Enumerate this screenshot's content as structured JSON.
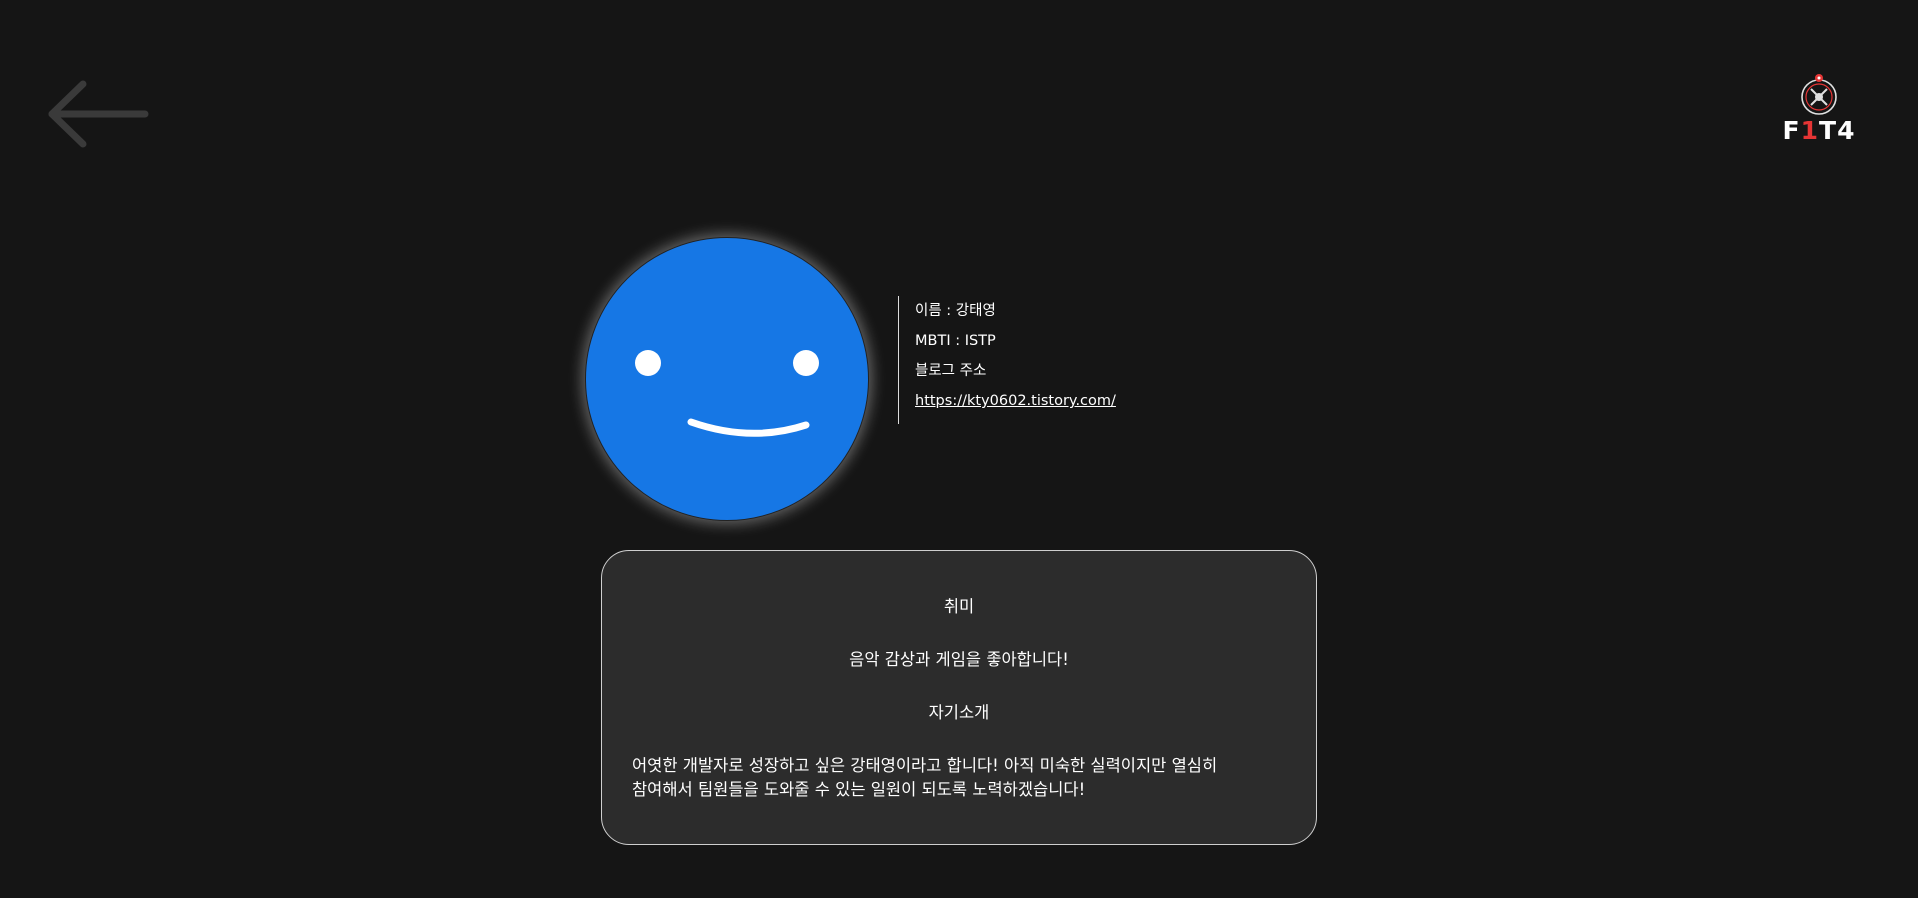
{
  "header": {
    "back_icon": "arrow-left-icon",
    "logo": {
      "icon": "fit4-logo-icon",
      "text_prefix": "F",
      "text_accent": "1",
      "text_suffix": "T4",
      "accent_color": "#e53535"
    }
  },
  "profile": {
    "avatar_icon": "smiley-face-icon",
    "avatar_color": "#1677e5",
    "name_line": "이름 : 강태영",
    "mbti_line": "MBTI : ISTP",
    "blog_label": "블로그 주소",
    "blog_url": "https://kty0602.tistory.com/"
  },
  "card": {
    "hobby_title": "취미",
    "hobby_text": "음악 감상과 게임을 좋아합니다!",
    "intro_title": "자기소개",
    "intro_line1": "어엿한 개발자로 성장하고 싶은 강태영이라고 합니다! 아직 미숙한 실력이지만 열심히",
    "intro_line2": "참여해서 팀원들을 도와줄 수 있는 일원이 되도록 노력하겠습니다!"
  },
  "colors": {
    "background": "#151515",
    "card_background": "#2c2c2c"
  }
}
